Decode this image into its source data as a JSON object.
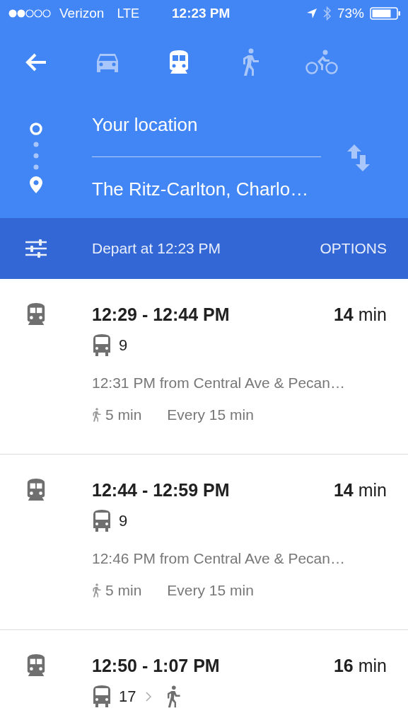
{
  "status_bar": {
    "carrier": "Verizon",
    "network": "LTE",
    "time": "12:23 PM",
    "battery": "73%"
  },
  "modes": [
    {
      "kind": "car",
      "selected": false
    },
    {
      "kind": "transit",
      "selected": true
    },
    {
      "kind": "walk",
      "selected": false
    },
    {
      "kind": "bike",
      "selected": false
    }
  ],
  "route": {
    "from": "Your location",
    "to": "The Ritz-Carlton, Charlo…"
  },
  "depart_bar": {
    "label": "Depart at 12:23 PM",
    "options": "OPTIONS"
  },
  "results": [
    {
      "times": "12:29 - 12:44 PM",
      "duration": "**14** min",
      "legs": [
        {
          "kind": "bus",
          "label": "9"
        }
      ],
      "departure": "12:31 PM from Central Ave & Pecan…",
      "walk": "5 min",
      "frequency": "Every 15 min"
    },
    {
      "times": "12:44 - 12:59 PM",
      "duration": "**14** min",
      "legs": [
        {
          "kind": "bus",
          "label": "9"
        }
      ],
      "departure": "12:46 PM from Central Ave & Pecan…",
      "walk": "5 min",
      "frequency": "Every 15 min"
    },
    {
      "times": "12:50 - 1:07 PM",
      "duration": "**16** min",
      "legs": [
        {
          "kind": "bus",
          "label": "17"
        },
        {
          "kind": "walk"
        }
      ]
    }
  ]
}
